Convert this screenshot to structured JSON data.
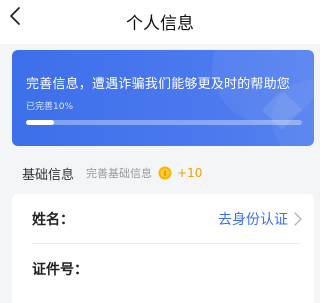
{
  "header": {
    "title": "个人信息"
  },
  "banner": {
    "headline": "完善信息，遭遇诈骗我们能够更及时的帮助您",
    "progress_label": "已完善10%",
    "progress_fraction": 0.1
  },
  "section": {
    "title": "基础信息",
    "hint": "完善基础信息",
    "reward": "+10"
  },
  "form": {
    "name_label": "姓名：",
    "name_action": "去身份认证",
    "id_label": "证件号："
  },
  "colors": {
    "accent": "#3d6fea",
    "reward": "#f0a000",
    "banner_bg": "#4a78ee"
  },
  "icons": {
    "back": "chevron-left-icon",
    "coin": "coin-icon",
    "row_arrow": "chevron-right-icon"
  }
}
